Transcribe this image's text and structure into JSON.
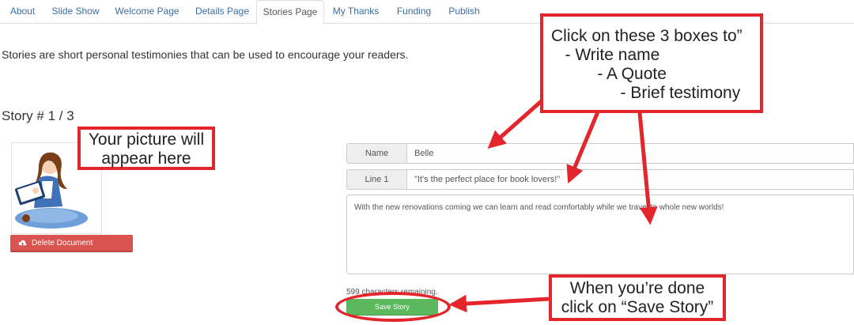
{
  "tabs": [
    {
      "label": "About",
      "active": false
    },
    {
      "label": "Slide Show",
      "active": false
    },
    {
      "label": "Welcome Page",
      "active": false
    },
    {
      "label": "Details Page",
      "active": false
    },
    {
      "label": "Stories Page",
      "active": true
    },
    {
      "label": "My Thanks",
      "active": false
    },
    {
      "label": "Funding",
      "active": false
    },
    {
      "label": "Publish",
      "active": false
    }
  ],
  "intro": "Stories are short personal testimonies that can be used to encourage your readers.",
  "story_heading": "Story # 1 / 3",
  "photo": {
    "delete_label": "Delete Document",
    "delete_icon": "cloud-upload-icon"
  },
  "form": {
    "name_label": "Name",
    "name_value": "Belle",
    "line1_label": "Line 1",
    "line1_value": "\"It's the perfect place for book lovers!\"",
    "testimony": "With the new renovations coming we can learn and read comfortably while we travel to whole new worlds!",
    "remaining": "599 characters remaining.",
    "save_label": "Save Story"
  },
  "annotations": {
    "picture": [
      "Your picture will",
      "appear here"
    ],
    "click": [
      "Click on these 3 boxes to”",
      "   - Write name",
      "          - A Quote",
      "               - Brief testimony"
    ],
    "done": [
      "When you’re done",
      "click on “Save Story”"
    ],
    "color": "#e3262c"
  },
  "colors": {
    "tab_link": "#3a6ea5",
    "danger": "#d9534f",
    "success": "#5cb85c"
  }
}
